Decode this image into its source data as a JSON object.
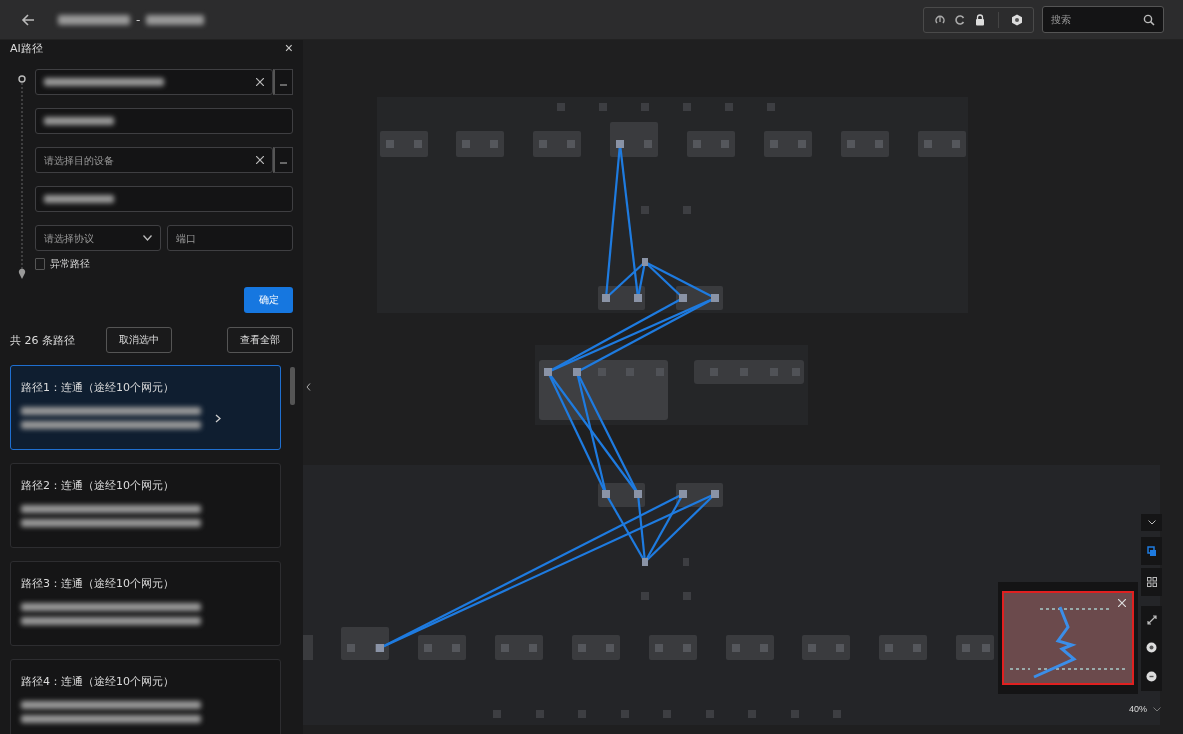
{
  "header": {
    "title_separator": "-"
  },
  "search": {
    "placeholder": "搜索"
  },
  "panel": {
    "title": "AI路径",
    "close": "×",
    "fields": [
      {
        "kind": "blurred",
        "clearable": true,
        "more": true
      },
      {
        "kind": "blurred",
        "clearable": false,
        "more": false
      },
      {
        "kind": "empty",
        "placeholder": "请选择目的设备",
        "clearable": true,
        "more": true
      },
      {
        "kind": "blurred",
        "clearable": false,
        "more": false
      }
    ],
    "protocol": {
      "placeholder": "请选择协议"
    },
    "port": {
      "placeholder": "端口"
    },
    "abnormal": {
      "label": "异常路径",
      "checked": false
    },
    "confirm": "确定",
    "count": "共 26 条路径",
    "deselect": "取消选中",
    "view_all": "查看全部",
    "paths": [
      {
        "title": "路径1：连通（途经10个网元）",
        "selected": true
      },
      {
        "title": "路径2：连通（途经10个网元）",
        "selected": false
      },
      {
        "title": "路径3：连通（途经10个网元）",
        "selected": false
      },
      {
        "title": "路径4：连通（途经10个网元）",
        "selected": false
      }
    ]
  },
  "zoom": {
    "value": "40%"
  }
}
